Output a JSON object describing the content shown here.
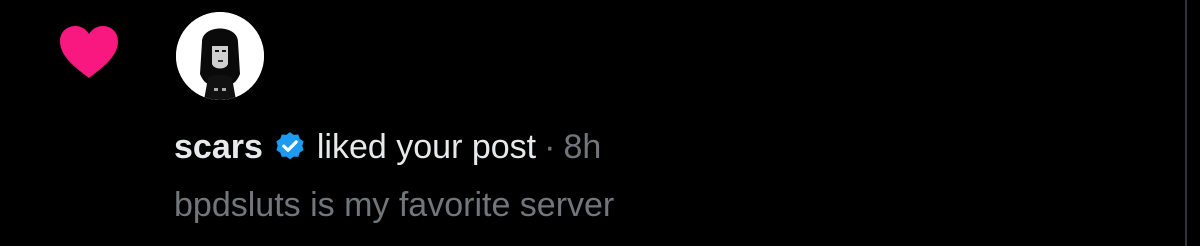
{
  "notification": {
    "type_icon": "heart-icon",
    "avatar_icon": "user-avatar",
    "username": "scars",
    "verified_icon": "verified-badge-icon",
    "action": "liked your post",
    "separator": "·",
    "timestamp": "8h",
    "post_text": "bpdsluts is my favorite server"
  },
  "colors": {
    "background": "#000000",
    "heart": "#f91880",
    "verified": "#1d9bf0",
    "primary_text": "#e7e9ea",
    "secondary_text": "#71767b"
  }
}
